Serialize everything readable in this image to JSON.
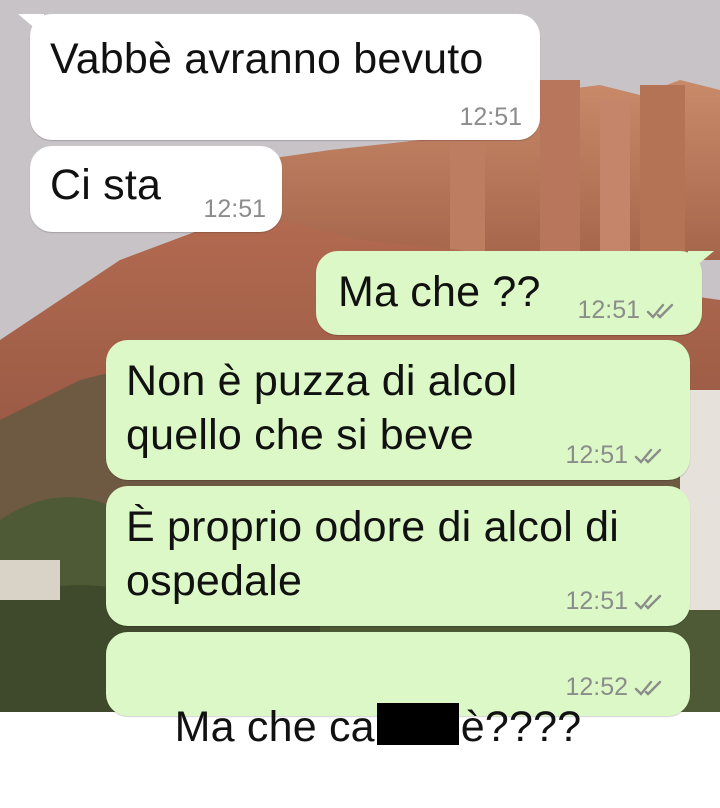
{
  "chat": {
    "messages": [
      {
        "direction": "incoming",
        "text": "Vabbè avranno bevuto",
        "time": "12:51"
      },
      {
        "direction": "incoming",
        "text": "Ci sta",
        "time": "12:51"
      },
      {
        "direction": "outgoing",
        "text": "Ma che ??",
        "time": "12:51",
        "status": "read"
      },
      {
        "direction": "outgoing",
        "text": "Non è puzza di alcol\nquello che si beve",
        "time": "12:51",
        "status": "read"
      },
      {
        "direction": "outgoing",
        "text": "È proprio odore di alcol di\nospedale",
        "time": "12:51",
        "status": "read"
      },
      {
        "direction": "outgoing",
        "text_before": "Ma che ca",
        "text_after": "è????",
        "redacted": true,
        "time": "12:52",
        "status": "read"
      }
    ]
  },
  "colors": {
    "incoming_bubble": "#ffffff",
    "outgoing_bubble": "#dcf8c6",
    "timestamp": "#8a8d8a"
  },
  "icons": {
    "status": "double-check-icon"
  }
}
